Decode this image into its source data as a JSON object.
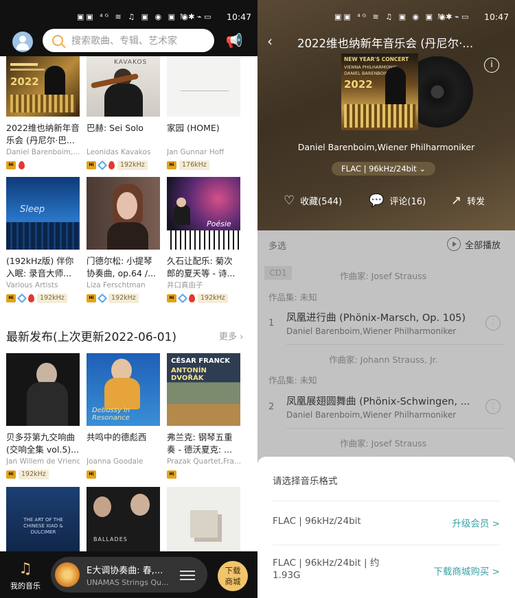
{
  "left": {
    "status_time": "10:47",
    "search_placeholder": "搜索歌曲、专辑、艺术家",
    "grid1": [
      {
        "title": "2022维也纳新年音乐会 (丹尼尔·巴...",
        "artist": "Daniel Barenboim,...",
        "khz": ""
      },
      {
        "title": "巴赫: Sei Solo",
        "artist": "Leonidas Kavakos",
        "khz": "192kHz"
      },
      {
        "title": "家园 (HOME)",
        "artist": "Jan Gunnar Hoff",
        "khz": "176kHz"
      }
    ],
    "grid2": [
      {
        "title": "(192kHz版) 伴你入眠: 录音大师...",
        "artist": "Various Artists",
        "khz": "192kHz"
      },
      {
        "title": "门德尔松: 小提琴协奏曲, op.64 /...",
        "artist": "Liza Ferschtman",
        "khz": "192kHz"
      },
      {
        "title": "久石让配乐: 菊次郎的夏天等 - 诗...",
        "artist": "井口真由子",
        "khz": "192kHz"
      }
    ],
    "section_title": "最新发布(上次更新2022-06-01)",
    "section_more": "更多",
    "grid3": [
      {
        "title": "贝多芬第九交响曲 (交响全集 vol.5)...",
        "artist": "Jan Willem de Vriend",
        "khz": "192kHz"
      },
      {
        "title": "共鸣中的德彪西",
        "artist": "Joanna Goodale",
        "khz": ""
      },
      {
        "title": "弗兰克: 钢琴五重奏 - 德沃夏克: ...",
        "artist": "Prazak Quartet,Fra...",
        "khz": ""
      }
    ],
    "cover_text": {
      "c1": "2022",
      "c2": "KAVAKOS",
      "c5": "Sleep",
      "c8": "Debussy in Resonance",
      "c9a": "CÉSAR FRANCK",
      "c9b": "ANTONÍN DVOŘÁK",
      "c6": "Poésie",
      "c4": "BALLADES",
      "c3": "THE ART OF THE CHINESE XIAO & DULCIMER"
    },
    "my_music_label": "我的音乐",
    "player_title": "E大调协奏曲: 春,...",
    "player_artist": "UNAMAS Strings Qu...",
    "download_label_1": "下载",
    "download_label_2": "商城"
  },
  "right": {
    "status_time": "10:47",
    "title": "2022维也纳新年音乐会 (丹尼尔·...",
    "cover_line1": "NEW YEAR'S CONCERT",
    "cover_line2": "VIENNA PHILHARMONIC",
    "cover_line3": "DANIEL BARENBOIM",
    "cover_year": "2022",
    "artist": "Daniel Barenboim,Wiener Philharmoniker",
    "format_pill": "FLAC | 96kHz/24bit",
    "favorite_label": "收藏(544)",
    "comment_label": "评论(16)",
    "share_label": "转发",
    "multi_select": "多选",
    "play_all": "全部播放",
    "cd_tag": "CD1",
    "composer1": "作曲家:  Josef Strauss",
    "work1": "作品集:  未知",
    "track1_num": "1",
    "track1_name": "凤凰进行曲 (Phönix-Marsch, Op. 105)",
    "track1_artist": "Daniel Barenboim,Wiener Philharmoniker",
    "composer2": "作曲家:  Johann Strauss, Jr.",
    "work2": "作品集:  未知",
    "track2_num": "2",
    "track2_name": "凤凰展翅圆舞曲 (Phönix-Schwingen, ...",
    "track2_artist": "Daniel Barenboim,Wiener Philharmoniker",
    "composer3": "作曲家:  Josef Strauss",
    "sheet_title": "请选择音乐格式",
    "opt1_name": "FLAC | 96kHz/24bit",
    "opt1_action": "升级会员 >",
    "opt2_name_1": "FLAC | 96kHz/24bit | 约",
    "opt2_name_2": "1.93G",
    "opt2_action": "下载商城购买 >"
  },
  "colors": {
    "accent": "#3aa2a6",
    "gold": "#f2c46b",
    "hires": "#e3a31a"
  }
}
